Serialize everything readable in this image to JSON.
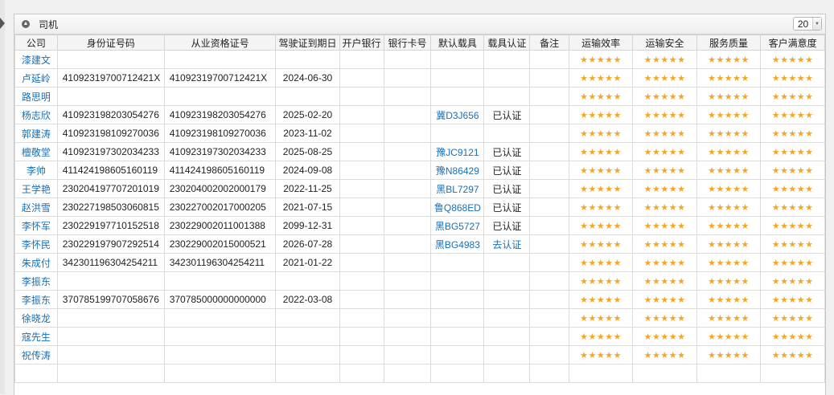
{
  "panel": {
    "title": "司机",
    "page_size": "20"
  },
  "table": {
    "headers": [
      "公司",
      "身份证号码",
      "从业资格证号",
      "驾驶证到期日",
      "开户银行",
      "银行卡号",
      "默认载具",
      "载具认证",
      "备注",
      "运输效率",
      "运输安全",
      "服务质量",
      "客户满意度"
    ],
    "rating": "★★★★★",
    "rows": [
      {
        "name": "漆建文",
        "id_no": "",
        "qual_no": "",
        "expiry": "",
        "vehicle": "",
        "cert": ""
      },
      {
        "name": "卢延岭",
        "id_no": "41092319700712421X",
        "qual_no": "41092319700712421X",
        "expiry": "2024-06-30",
        "vehicle": "",
        "cert": ""
      },
      {
        "name": "路思明",
        "id_no": "",
        "qual_no": "",
        "expiry": "",
        "vehicle": "",
        "cert": ""
      },
      {
        "name": "杨志欣",
        "id_no": "410923198203054276",
        "qual_no": "410923198203054276",
        "expiry": "2025-02-20",
        "vehicle": "冀D3J656",
        "cert": "已认证"
      },
      {
        "name": "郭建涛",
        "id_no": "410923198109270036",
        "qual_no": "410923198109270036",
        "expiry": "2023-11-02",
        "vehicle": "",
        "cert": ""
      },
      {
        "name": "檀敬堂",
        "id_no": "410923197302034233",
        "qual_no": "410923197302034233",
        "expiry": "2025-08-25",
        "vehicle": "豫JC9121",
        "cert": "已认证"
      },
      {
        "name": "李帅",
        "id_no": "411424198605160119",
        "qual_no": "411424198605160119",
        "expiry": "2024-09-08",
        "vehicle": "豫N86429",
        "cert": "已认证"
      },
      {
        "name": "王学艳",
        "id_no": "230204197707201019",
        "qual_no": "230204002002000179",
        "expiry": "2022-11-25",
        "vehicle": "黑BL7297",
        "cert": "已认证"
      },
      {
        "name": "赵洪雪",
        "id_no": "230227198503060815",
        "qual_no": "230227002017000205",
        "expiry": "2021-07-15",
        "vehicle": "鲁Q868ED",
        "cert": "已认证"
      },
      {
        "name": "李怀军",
        "id_no": "230229197710152518",
        "qual_no": "230229002011001388",
        "expiry": "2099-12-31",
        "vehicle": "黑BG5727",
        "cert": "已认证"
      },
      {
        "name": "李怀民",
        "id_no": "230229197907292514",
        "qual_no": "230229002015000521",
        "expiry": "2026-07-28",
        "vehicle": "黑BG4983",
        "cert": "去认证"
      },
      {
        "name": "朱成付",
        "id_no": "342301196304254211",
        "qual_no": "342301196304254211",
        "expiry": "2021-01-22",
        "vehicle": "",
        "cert": ""
      },
      {
        "name": "李振东",
        "id_no": "",
        "qual_no": "",
        "expiry": "",
        "vehicle": "",
        "cert": ""
      },
      {
        "name": "李振东",
        "id_no": "370785199707058676",
        "qual_no": "370785000000000000",
        "expiry": "2022-03-08",
        "vehicle": "",
        "cert": ""
      },
      {
        "name": "徐晓龙",
        "id_no": "",
        "qual_no": "",
        "expiry": "",
        "vehicle": "",
        "cert": ""
      },
      {
        "name": "寇先生",
        "id_no": "",
        "qual_no": "",
        "expiry": "",
        "vehicle": "",
        "cert": ""
      },
      {
        "name": "祝传涛",
        "id_no": "",
        "qual_no": "",
        "expiry": "",
        "vehicle": "",
        "cert": ""
      },
      {
        "name": "",
        "id_no": "",
        "qual_no": "",
        "expiry": "",
        "vehicle": "",
        "cert": ""
      }
    ]
  },
  "colors": {
    "link": "#1a6fb5",
    "star": "#f5a623"
  }
}
